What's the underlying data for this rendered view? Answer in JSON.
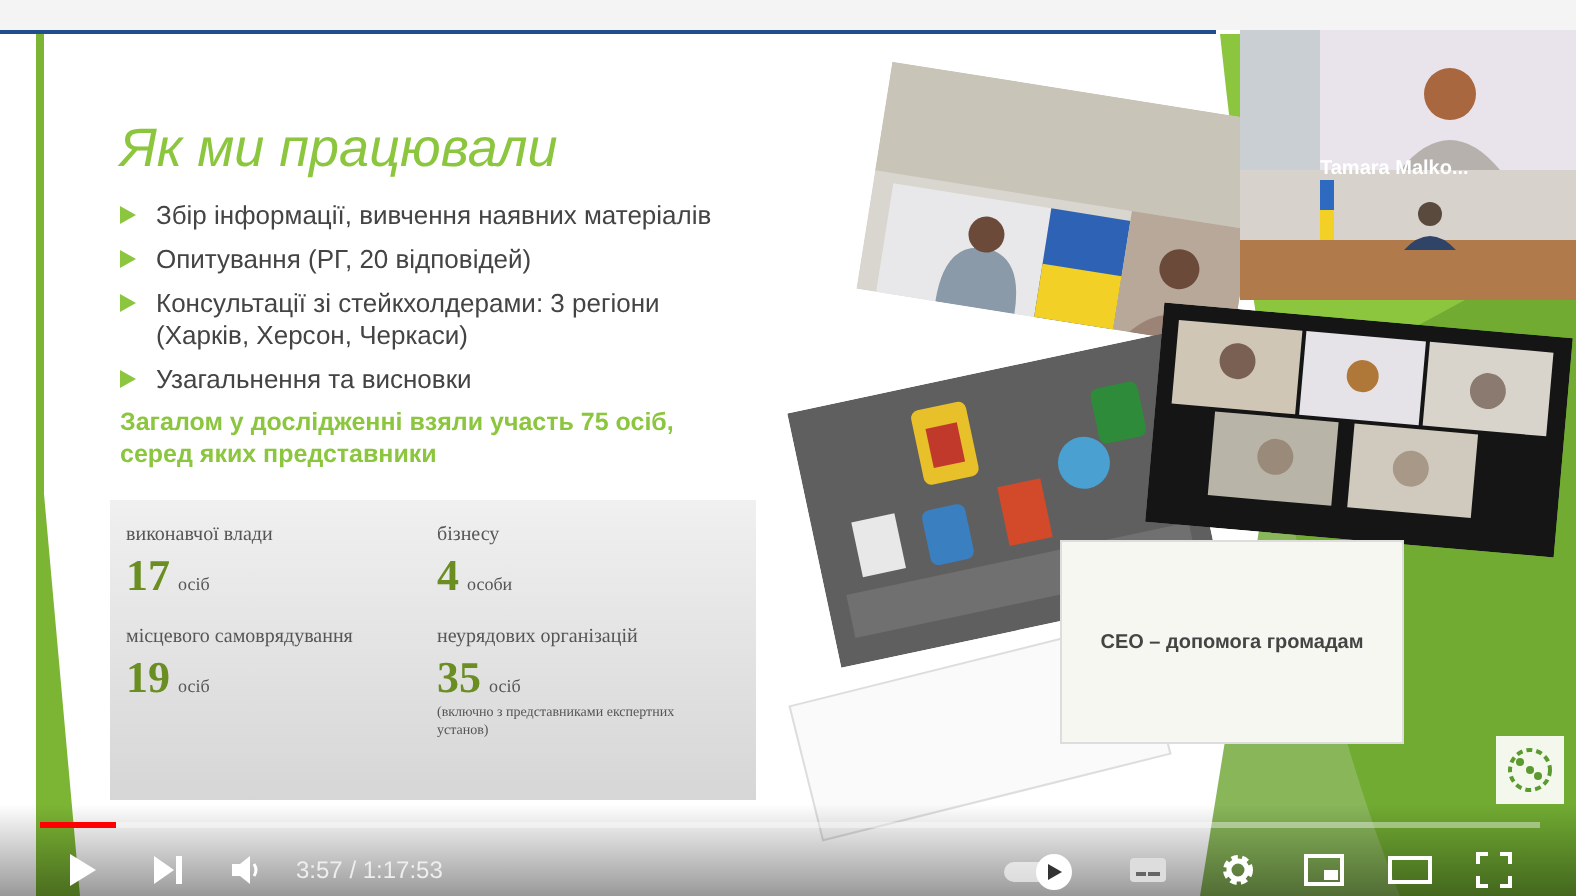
{
  "slide": {
    "title": "Як ми працювали",
    "bullets": [
      "Збір інформації, вивчення наявних матеріалів",
      "Опитування (РГ, 20 відповідей)",
      "Консультації зі стейкхолдерами: 3 регіони (Харків, Херсон, Черкаси)",
      "Узагальнення та висновки"
    ],
    "summary": "Загалом у дослідженні взяли участь 75 осіб, серед яких представники",
    "stats": [
      {
        "label": "виконавчої влади",
        "number": "17",
        "unit": "осіб"
      },
      {
        "label": "бізнесу",
        "number": "4",
        "unit": "особи"
      },
      {
        "label": "місцевого самоврядування",
        "number": "19",
        "unit": "осіб"
      },
      {
        "label": "неурядових організацій",
        "number": "35",
        "unit": "осіб",
        "note": "(включно з представниками експертних установ)"
      }
    ],
    "collage": {
      "name_label": "Tamara Malko...",
      "mini_slide_title": "СЕО – допомога громадам"
    }
  },
  "player": {
    "progress": {
      "level": 0.05
    },
    "time": "3:57 / 1:17:53",
    "autoplay": {
      "on": true
    }
  }
}
